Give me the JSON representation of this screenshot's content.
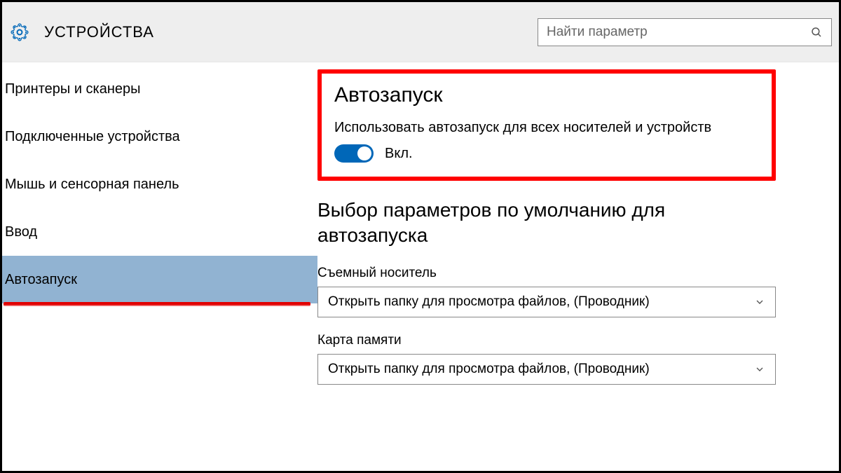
{
  "header": {
    "title": "УСТРОЙСТВА",
    "search_placeholder": "Найти параметр"
  },
  "sidebar": {
    "items": [
      {
        "label": "Принтеры и сканеры"
      },
      {
        "label": "Подключенные устройства"
      },
      {
        "label": "Мышь и сенсорная панель"
      },
      {
        "label": "Ввод"
      },
      {
        "label": "Автозапуск"
      }
    ],
    "selected_index": 4
  },
  "main": {
    "autoplay_section_title": "Автозапуск",
    "autoplay_toggle_desc": "Использовать автозапуск для всех носителей и устройств",
    "autoplay_toggle_state_label": "Вкл.",
    "autoplay_toggle_on": true,
    "defaults_title": "Выбор параметров по умолчанию для автозапуска",
    "fields": [
      {
        "label": "Съемный носитель",
        "value": "Открыть папку для просмотра файлов, (Проводник)"
      },
      {
        "label": "Карта памяти",
        "value": "Открыть папку для просмотра файлов, (Проводник)"
      }
    ]
  }
}
